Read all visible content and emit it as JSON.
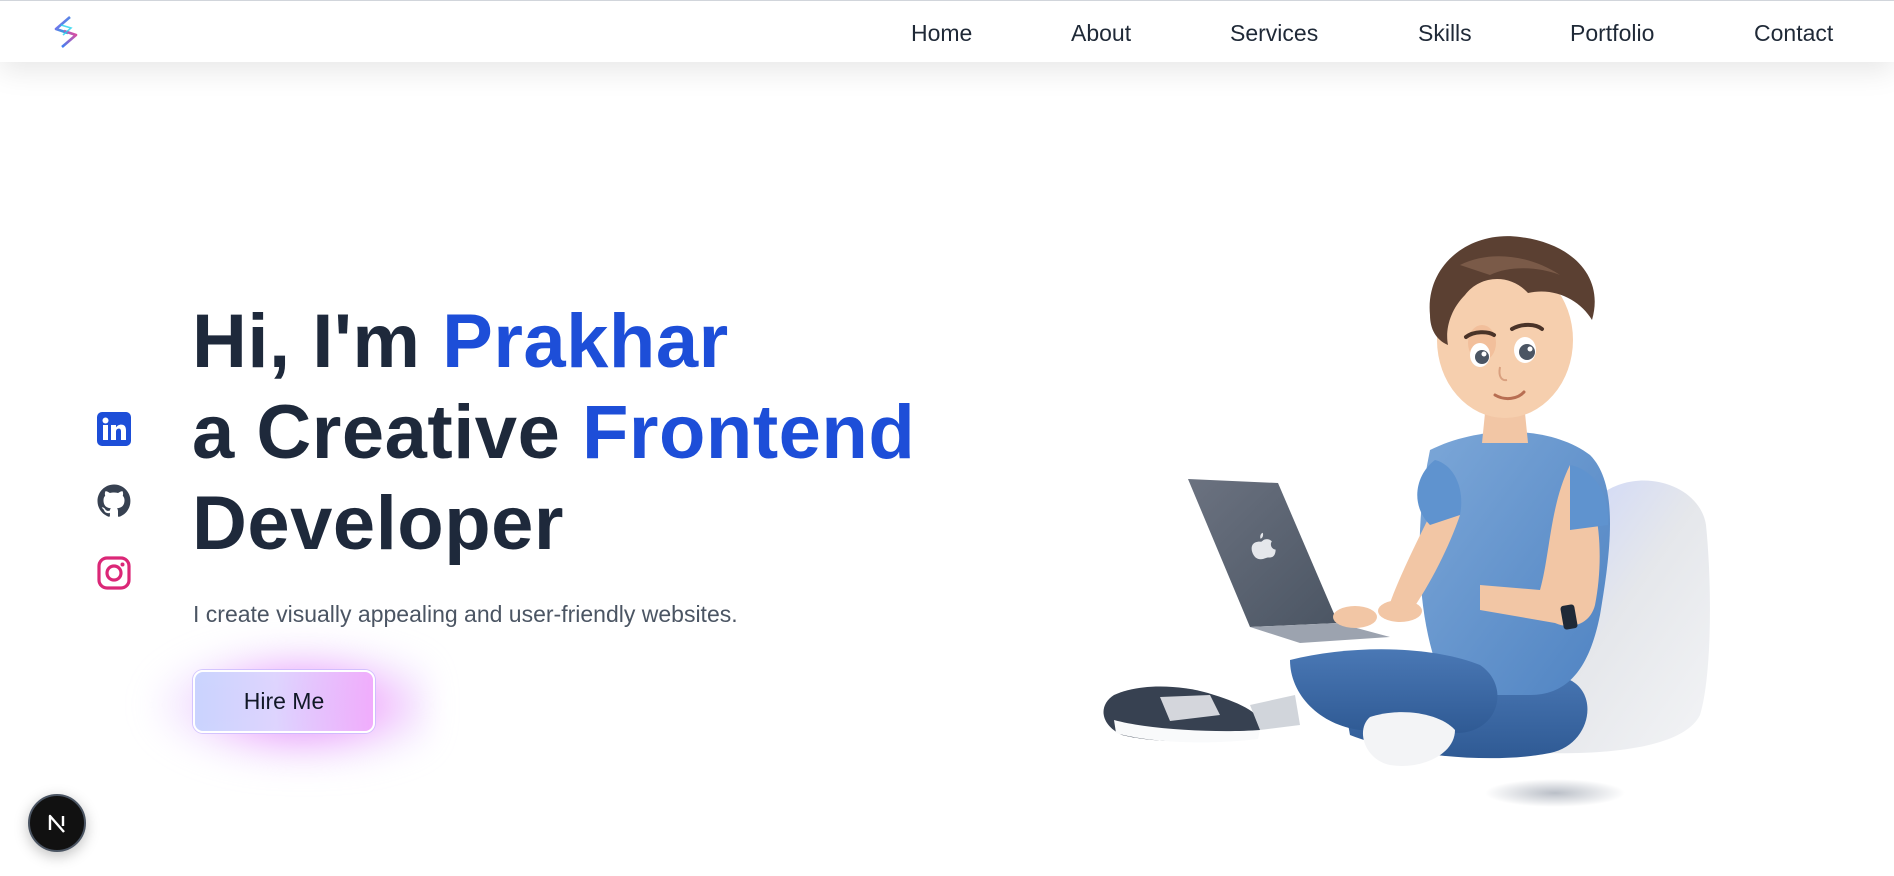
{
  "nav": {
    "items": [
      {
        "label": "Home"
      },
      {
        "label": "About"
      },
      {
        "label": "Services"
      },
      {
        "label": "Skills"
      },
      {
        "label": "Portfolio"
      },
      {
        "label": "Contact"
      }
    ]
  },
  "hero": {
    "line1_prefix": "Hi, I'm",
    "line1_accent": "Prakhar",
    "line2_prefix": "a Creative",
    "line2_accent": "Frontend",
    "line3": "Developer",
    "tagline": "I create visually appealing and user-friendly websites.",
    "cta_label": "Hire Me"
  },
  "social": [
    {
      "icon": "linkedin-icon",
      "color": "#1d4ed8"
    },
    {
      "icon": "github-icon",
      "color": "#374151"
    },
    {
      "icon": "instagram-icon",
      "color": "#db2777"
    }
  ],
  "colors": {
    "accent": "#1d4ed8",
    "heading": "#1e293b",
    "body_text": "#4b5563"
  },
  "icons": {
    "logo": "brand-logo-icon",
    "illustration": "developer-with-laptop-illustration",
    "dev_indicator": "nextjs-icon"
  }
}
